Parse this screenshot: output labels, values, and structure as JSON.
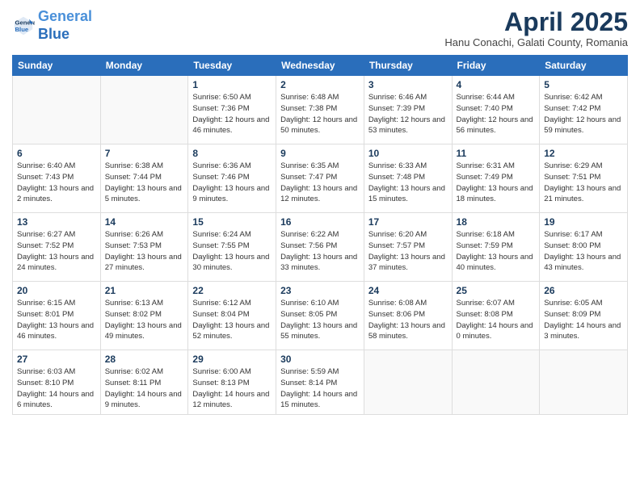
{
  "header": {
    "logo_line1": "General",
    "logo_line2": "Blue",
    "month_title": "April 2025",
    "subtitle": "Hanu Conachi, Galati County, Romania"
  },
  "days_of_week": [
    "Sunday",
    "Monday",
    "Tuesday",
    "Wednesday",
    "Thursday",
    "Friday",
    "Saturday"
  ],
  "weeks": [
    [
      {
        "day": "",
        "info": ""
      },
      {
        "day": "",
        "info": ""
      },
      {
        "day": "1",
        "info": "Sunrise: 6:50 AM\nSunset: 7:36 PM\nDaylight: 12 hours and 46 minutes."
      },
      {
        "day": "2",
        "info": "Sunrise: 6:48 AM\nSunset: 7:38 PM\nDaylight: 12 hours and 50 minutes."
      },
      {
        "day": "3",
        "info": "Sunrise: 6:46 AM\nSunset: 7:39 PM\nDaylight: 12 hours and 53 minutes."
      },
      {
        "day": "4",
        "info": "Sunrise: 6:44 AM\nSunset: 7:40 PM\nDaylight: 12 hours and 56 minutes."
      },
      {
        "day": "5",
        "info": "Sunrise: 6:42 AM\nSunset: 7:42 PM\nDaylight: 12 hours and 59 minutes."
      }
    ],
    [
      {
        "day": "6",
        "info": "Sunrise: 6:40 AM\nSunset: 7:43 PM\nDaylight: 13 hours and 2 minutes."
      },
      {
        "day": "7",
        "info": "Sunrise: 6:38 AM\nSunset: 7:44 PM\nDaylight: 13 hours and 5 minutes."
      },
      {
        "day": "8",
        "info": "Sunrise: 6:36 AM\nSunset: 7:46 PM\nDaylight: 13 hours and 9 minutes."
      },
      {
        "day": "9",
        "info": "Sunrise: 6:35 AM\nSunset: 7:47 PM\nDaylight: 13 hours and 12 minutes."
      },
      {
        "day": "10",
        "info": "Sunrise: 6:33 AM\nSunset: 7:48 PM\nDaylight: 13 hours and 15 minutes."
      },
      {
        "day": "11",
        "info": "Sunrise: 6:31 AM\nSunset: 7:49 PM\nDaylight: 13 hours and 18 minutes."
      },
      {
        "day": "12",
        "info": "Sunrise: 6:29 AM\nSunset: 7:51 PM\nDaylight: 13 hours and 21 minutes."
      }
    ],
    [
      {
        "day": "13",
        "info": "Sunrise: 6:27 AM\nSunset: 7:52 PM\nDaylight: 13 hours and 24 minutes."
      },
      {
        "day": "14",
        "info": "Sunrise: 6:26 AM\nSunset: 7:53 PM\nDaylight: 13 hours and 27 minutes."
      },
      {
        "day": "15",
        "info": "Sunrise: 6:24 AM\nSunset: 7:55 PM\nDaylight: 13 hours and 30 minutes."
      },
      {
        "day": "16",
        "info": "Sunrise: 6:22 AM\nSunset: 7:56 PM\nDaylight: 13 hours and 33 minutes."
      },
      {
        "day": "17",
        "info": "Sunrise: 6:20 AM\nSunset: 7:57 PM\nDaylight: 13 hours and 37 minutes."
      },
      {
        "day": "18",
        "info": "Sunrise: 6:18 AM\nSunset: 7:59 PM\nDaylight: 13 hours and 40 minutes."
      },
      {
        "day": "19",
        "info": "Sunrise: 6:17 AM\nSunset: 8:00 PM\nDaylight: 13 hours and 43 minutes."
      }
    ],
    [
      {
        "day": "20",
        "info": "Sunrise: 6:15 AM\nSunset: 8:01 PM\nDaylight: 13 hours and 46 minutes."
      },
      {
        "day": "21",
        "info": "Sunrise: 6:13 AM\nSunset: 8:02 PM\nDaylight: 13 hours and 49 minutes."
      },
      {
        "day": "22",
        "info": "Sunrise: 6:12 AM\nSunset: 8:04 PM\nDaylight: 13 hours and 52 minutes."
      },
      {
        "day": "23",
        "info": "Sunrise: 6:10 AM\nSunset: 8:05 PM\nDaylight: 13 hours and 55 minutes."
      },
      {
        "day": "24",
        "info": "Sunrise: 6:08 AM\nSunset: 8:06 PM\nDaylight: 13 hours and 58 minutes."
      },
      {
        "day": "25",
        "info": "Sunrise: 6:07 AM\nSunset: 8:08 PM\nDaylight: 14 hours and 0 minutes."
      },
      {
        "day": "26",
        "info": "Sunrise: 6:05 AM\nSunset: 8:09 PM\nDaylight: 14 hours and 3 minutes."
      }
    ],
    [
      {
        "day": "27",
        "info": "Sunrise: 6:03 AM\nSunset: 8:10 PM\nDaylight: 14 hours and 6 minutes."
      },
      {
        "day": "28",
        "info": "Sunrise: 6:02 AM\nSunset: 8:11 PM\nDaylight: 14 hours and 9 minutes."
      },
      {
        "day": "29",
        "info": "Sunrise: 6:00 AM\nSunset: 8:13 PM\nDaylight: 14 hours and 12 minutes."
      },
      {
        "day": "30",
        "info": "Sunrise: 5:59 AM\nSunset: 8:14 PM\nDaylight: 14 hours and 15 minutes."
      },
      {
        "day": "",
        "info": ""
      },
      {
        "day": "",
        "info": ""
      },
      {
        "day": "",
        "info": ""
      }
    ]
  ]
}
